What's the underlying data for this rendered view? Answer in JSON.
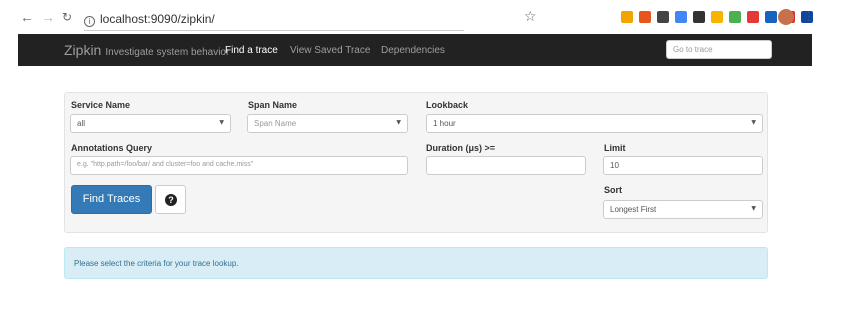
{
  "browser": {
    "url": "localhost:9090/zipkin/",
    "ext_colors": [
      "#f0a500",
      "#e8541e",
      "#444444",
      "#4285f4",
      "#333333",
      "#f6b400",
      "#4caf50",
      "#e53935",
      "#1565c0",
      "#d32f2f",
      "#0d47a1"
    ]
  },
  "navbar": {
    "brand": "Zipkin",
    "tagline": "Investigate system behavior",
    "links": [
      "Find a trace",
      "View Saved Trace",
      "Dependencies"
    ],
    "goto_placeholder": "Go to trace"
  },
  "form": {
    "service_name": {
      "label": "Service Name",
      "value": "all"
    },
    "span_name": {
      "label": "Span Name",
      "placeholder": "Span Name"
    },
    "lookback": {
      "label": "Lookback",
      "value": "1 hour"
    },
    "annotations": {
      "label": "Annotations Query",
      "placeholder": "e.g. \"http.path=/foo/bar/ and cluster=foo and cache.miss\""
    },
    "duration": {
      "label": "Duration (μs) >=",
      "value": ""
    },
    "limit": {
      "label": "Limit",
      "value": "10"
    },
    "sort": {
      "label": "Sort",
      "value": "Longest First"
    },
    "find_button": "Find Traces",
    "help_glyph": "?"
  },
  "alert": {
    "message": "Please select the criteria for your trace lookup."
  },
  "colors": {
    "navbar_bg": "#222222",
    "primary": "#337ab7",
    "alert_bg": "#d9edf7",
    "alert_text": "#31708f"
  }
}
